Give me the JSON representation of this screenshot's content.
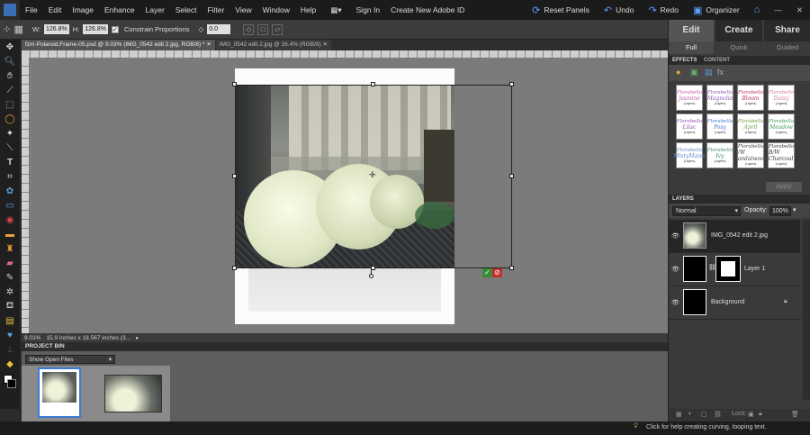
{
  "menubar": {
    "items": [
      "File",
      "Edit",
      "Image",
      "Enhance",
      "Layer",
      "Select",
      "Filter",
      "View",
      "Window",
      "Help"
    ],
    "sign_in": "Sign In",
    "create_id": "Create New Adobe ID",
    "reset_panels": "Reset Panels",
    "undo": "Undo",
    "redo": "Redo",
    "organizer": "Organizer"
  },
  "options": {
    "w_label": "W:",
    "w_value": "126.8%",
    "h_label": "H:",
    "h_value": "126.8%",
    "constrain": "Constrain Proportions",
    "angle": "0.0"
  },
  "doc_tabs": [
    {
      "label": "fzm-Polaroid.Frame-05.psd @ 9.03% (IMG_0542 edit 2.jpg, RGB/8) *"
    },
    {
      "label": "IMG_0542 edit 2.jpg @ 16.4% (RGB/8)"
    }
  ],
  "status": {
    "zoom": "9.03%",
    "info": "15.9 inches x 18.567 inches (3..."
  },
  "project_bin": {
    "title": "PROJECT BIN",
    "select": "Show Open Files"
  },
  "right_panel": {
    "tabs": [
      "Edit",
      "Create",
      "Share"
    ],
    "subtabs": [
      "Full",
      "Quick",
      "Guided"
    ],
    "effects_tabs": [
      "EFFECTS",
      "CONTENT"
    ],
    "apply": "Apply",
    "layers_title": "LAYERS",
    "blend_mode": "Normal",
    "opacity_label": "Opacity:",
    "opacity_value": "100%",
    "lock_label": "Lock:"
  },
  "effects": [
    {
      "name": "Jasmine",
      "color": "#c25aa8"
    },
    {
      "name": "Magnolia",
      "color": "#8a5ab8"
    },
    {
      "name": "Bloom",
      "color": "#c0306a"
    },
    {
      "name": "Daisy",
      "color": "#d07aa0"
    },
    {
      "name": "Lilac",
      "color": "#8c4fb8"
    },
    {
      "name": "Posy",
      "color": "#3a7ad0"
    },
    {
      "name": "April",
      "color": "#6a9a3a"
    },
    {
      "name": "Meadow",
      "color": "#3a9a5a"
    },
    {
      "name": "MistyMaise",
      "color": "#5a8ad0"
    },
    {
      "name": "Ivy",
      "color": "#3a8a6a"
    },
    {
      "name": "B/W Sandalwood",
      "color": "#444444"
    },
    {
      "name": "B/W Charcoal",
      "color": "#333333"
    }
  ],
  "effect_brand": "Florabella",
  "effect_sub": "(Layers)",
  "layers": [
    {
      "name": "IMG_0542 edit 2.jpg"
    },
    {
      "name": "Layer 1"
    },
    {
      "name": "Background"
    }
  ],
  "help_text": "Click for help creating curving, looping text."
}
